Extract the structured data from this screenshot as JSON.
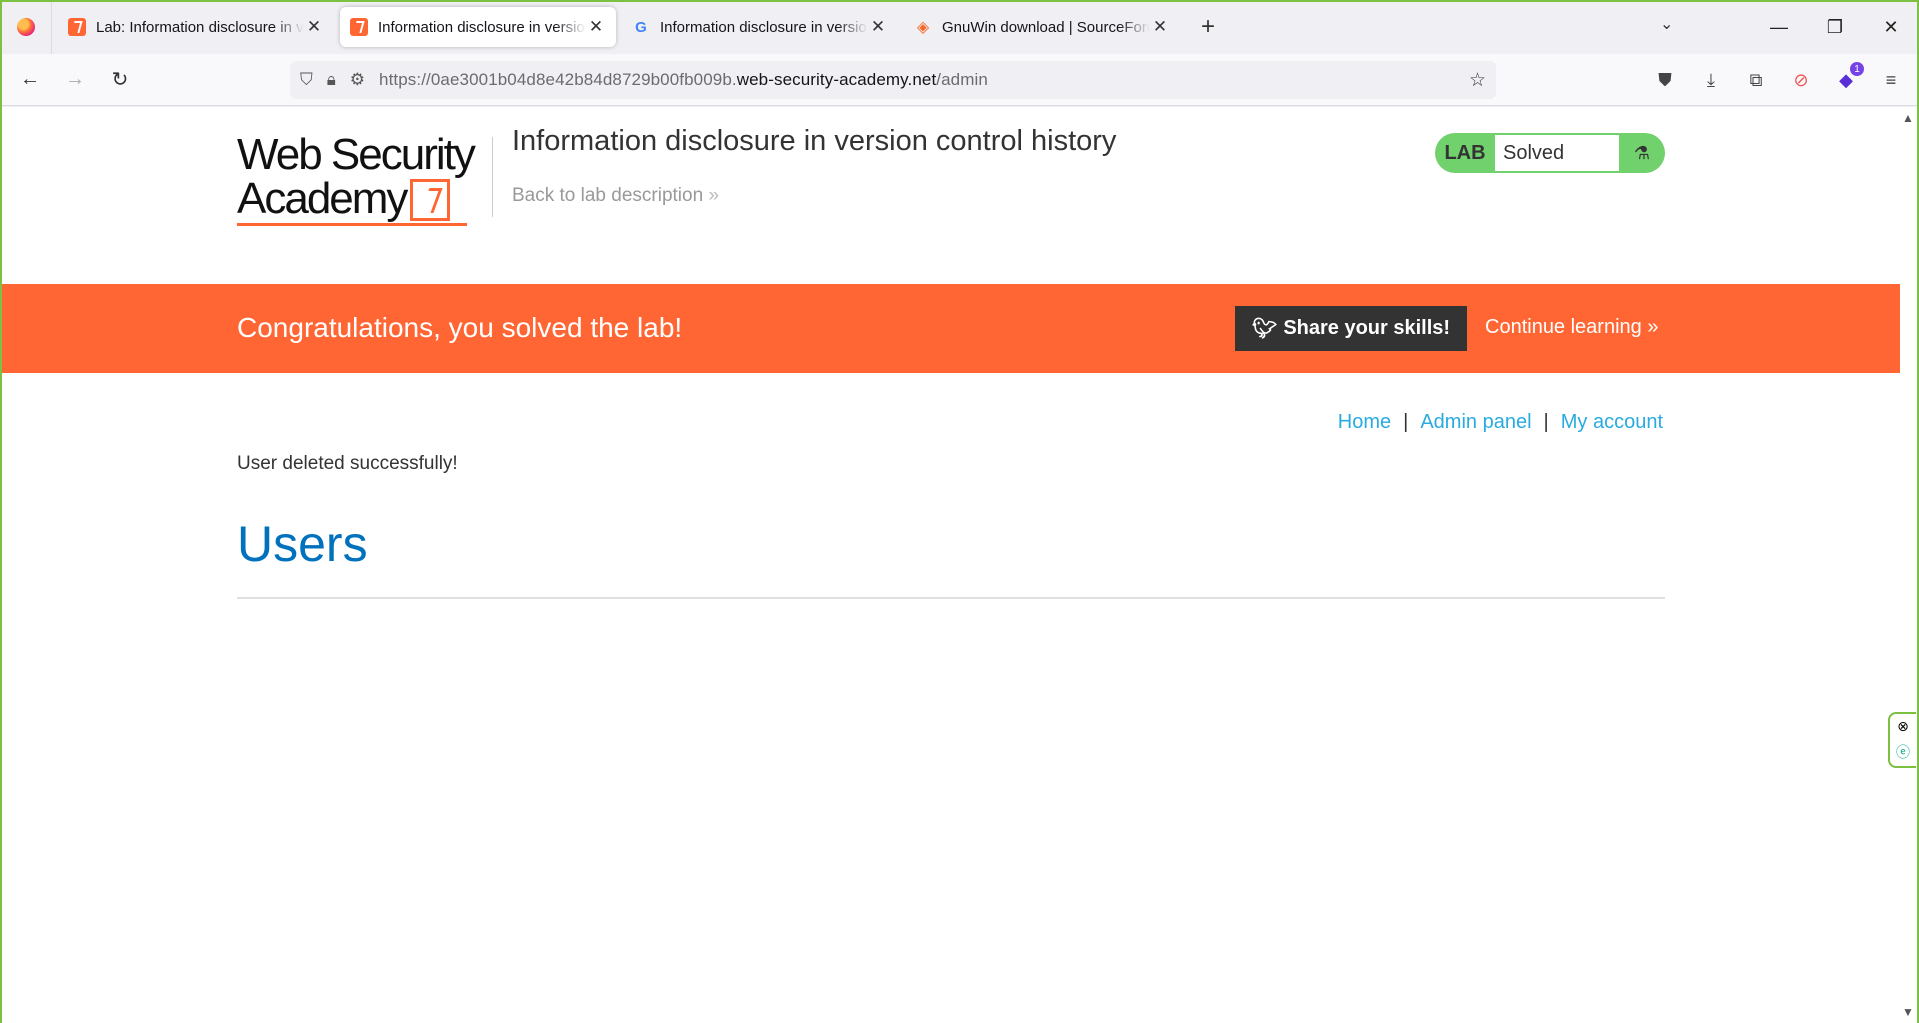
{
  "tabs": [
    {
      "title": "Lab: Information disclosure in version control history",
      "icon": "portswigger-icon",
      "active": false
    },
    {
      "title": "Information disclosure in version control history",
      "icon": "portswigger-icon",
      "active": true
    },
    {
      "title": "Information disclosure in version control history",
      "icon": "google-icon",
      "active": false
    },
    {
      "title": "GnuWin download | SourceForge.net",
      "icon": "sourceforge-icon",
      "active": false
    }
  ],
  "url": {
    "prefix": "https://0ae3001b04d8e42b84d8729b00fb009b.",
    "host": "web-security-academy.net",
    "path": "/admin"
  },
  "header": {
    "logo_line1": "Web Security",
    "logo_line2": "Academy",
    "lab_title": "Information disclosure in version control history",
    "back_link": "Back to lab description",
    "lab_label": "LAB",
    "lab_status": "Solved"
  },
  "banner": {
    "text": "Congratulations, you solved the lab!",
    "share": "Share your skills!",
    "continue": "Continue learning"
  },
  "nav": {
    "home": "Home",
    "admin": "Admin panel",
    "account": "My account",
    "sep": "|"
  },
  "main": {
    "message": "User deleted successfully!",
    "heading": "Users"
  },
  "extensions": {
    "badge_count": "1"
  },
  "colors": {
    "accent": "#ff6633",
    "link": "#29abe0",
    "heading": "#0071bc",
    "lab_green": "#70d16d"
  }
}
